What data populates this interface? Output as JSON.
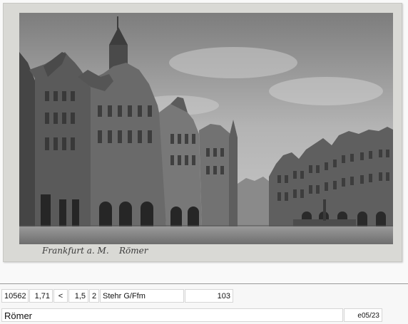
{
  "postcard": {
    "caption_city": "Frankfurt a. M.",
    "caption_name": "Römer"
  },
  "record": {
    "id": "10562",
    "value1": "1,71",
    "operator": "<",
    "value2": "1,5",
    "count": "2",
    "location": "Stehr G/Ffm",
    "number": "103"
  },
  "footer": {
    "title": "Römer",
    "code": "e05/23"
  },
  "colors": {
    "sky": "#b9b9b9",
    "building_dark": "#3c3c3c",
    "building_mid": "#6b6b6b",
    "pavement": "#8e8e8e"
  }
}
